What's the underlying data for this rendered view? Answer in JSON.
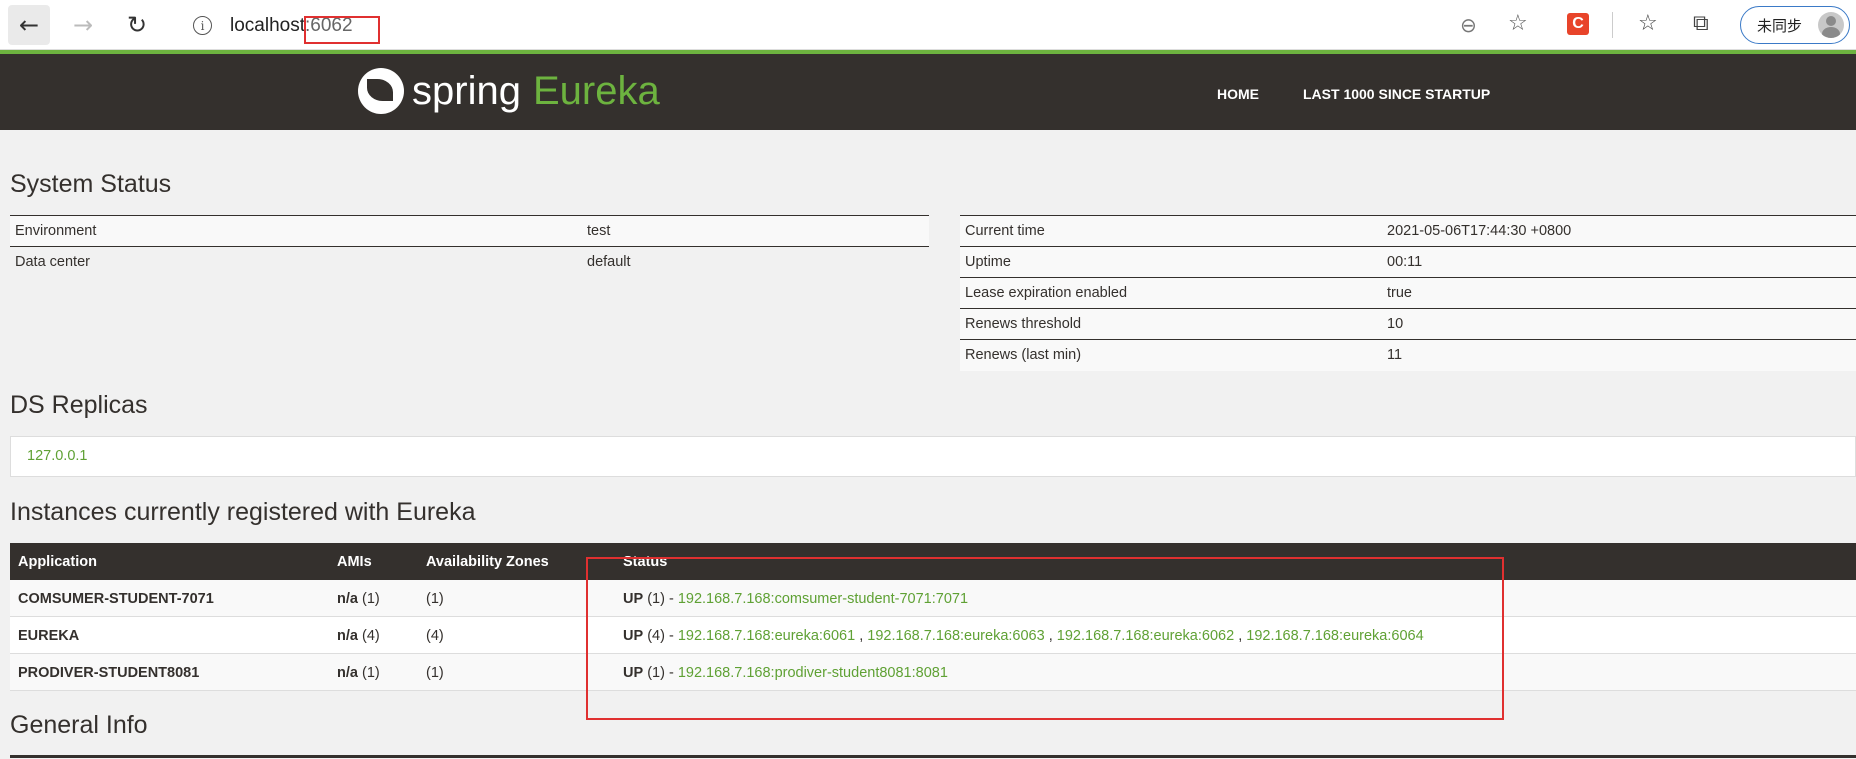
{
  "browser": {
    "host": "localhost",
    "port": ":6062",
    "profile_label": "未同步"
  },
  "navbar": {
    "logo_text": "spring",
    "logo_product": "Eureka",
    "home": "HOME",
    "last": "LAST 1000 SINCE STARTUP"
  },
  "system_status": {
    "title": "System Status",
    "left": [
      {
        "key": "Environment",
        "value": "test"
      },
      {
        "key": "Data center",
        "value": "default"
      }
    ],
    "right": [
      {
        "key": "Current time",
        "value": "2021-05-06T17:44:30 +0800"
      },
      {
        "key": "Uptime",
        "value": "00:11"
      },
      {
        "key": "Lease expiration enabled",
        "value": "true"
      },
      {
        "key": "Renews threshold",
        "value": "10"
      },
      {
        "key": "Renews (last min)",
        "value": "11"
      }
    ]
  },
  "replicas": {
    "title": "DS Replicas",
    "items": [
      "127.0.0.1"
    ]
  },
  "instances": {
    "title": "Instances currently registered with Eureka",
    "headers": [
      "Application",
      "AMIs",
      "Availability Zones",
      "Status"
    ],
    "rows": [
      {
        "app": "COMSUMER-STUDENT-7071",
        "ami": "n/a",
        "ami_count": "(1)",
        "zones": "(1)",
        "status": "UP",
        "status_count": "(1) -",
        "links": [
          "192.168.7.168:comsumer-student-7071:7071"
        ]
      },
      {
        "app": "EUREKA",
        "ami": "n/a",
        "ami_count": "(4)",
        "zones": "(4)",
        "status": "UP",
        "status_count": "(4) -",
        "links": [
          "192.168.7.168:eureka:6061",
          "192.168.7.168:eureka:6063",
          "192.168.7.168:eureka:6062",
          "192.168.7.168:eureka:6064"
        ]
      },
      {
        "app": "PRODIVER-STUDENT8081",
        "ami": "n/a",
        "ami_count": "(1)",
        "zones": "(1)",
        "status": "UP",
        "status_count": "(1) -",
        "links": [
          "192.168.7.168:prodiver-student8081:8081"
        ]
      }
    ]
  },
  "general": {
    "title": "General Info"
  },
  "icons": {
    "back": "arrow-left-icon",
    "forward": "arrow-right-icon",
    "reload": "reload-icon",
    "info": "info-icon",
    "zoom": "zoom-out-icon",
    "fav_add": "star-add-icon",
    "extension": "csdn-extension-icon",
    "favorites": "favorites-icon",
    "collections": "collections-icon"
  }
}
